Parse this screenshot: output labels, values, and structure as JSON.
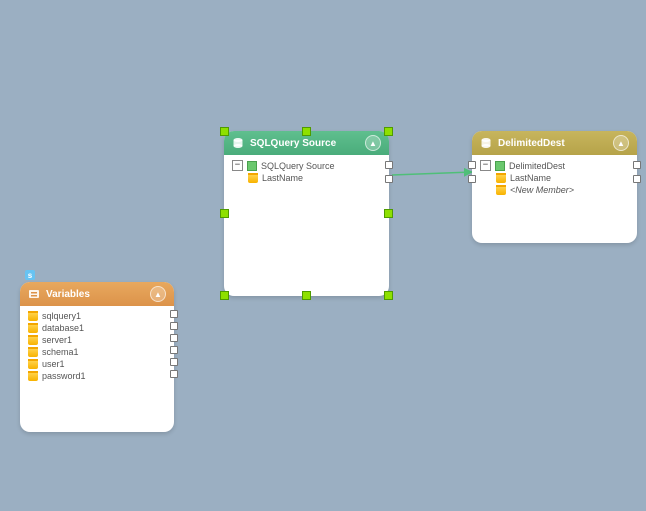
{
  "canvas": {
    "background": "#9bafc2"
  },
  "nodes": {
    "sql": {
      "title": "SQLQuery Source",
      "header_icon": "database-icon",
      "collapse_glyph": "▲",
      "root_label": "SQLQuery Source",
      "fields": [
        "LastName"
      ],
      "selected": true
    },
    "dest": {
      "title": "DelimitedDest",
      "header_icon": "database-icon",
      "collapse_glyph": "▲",
      "root_label": "DelimitedDest",
      "fields": [
        "LastName"
      ],
      "placeholder": "<New Member>"
    },
    "vars": {
      "title": "Variables",
      "header_icon": "variables-icon",
      "collapse_glyph": "▲",
      "badge": "s",
      "items": [
        "sqlquery1",
        "database1",
        "server1",
        "schema1",
        "user1",
        "password1"
      ]
    }
  },
  "edges": [
    {
      "from": "sql.LastName",
      "to": "dest.LastName"
    }
  ]
}
